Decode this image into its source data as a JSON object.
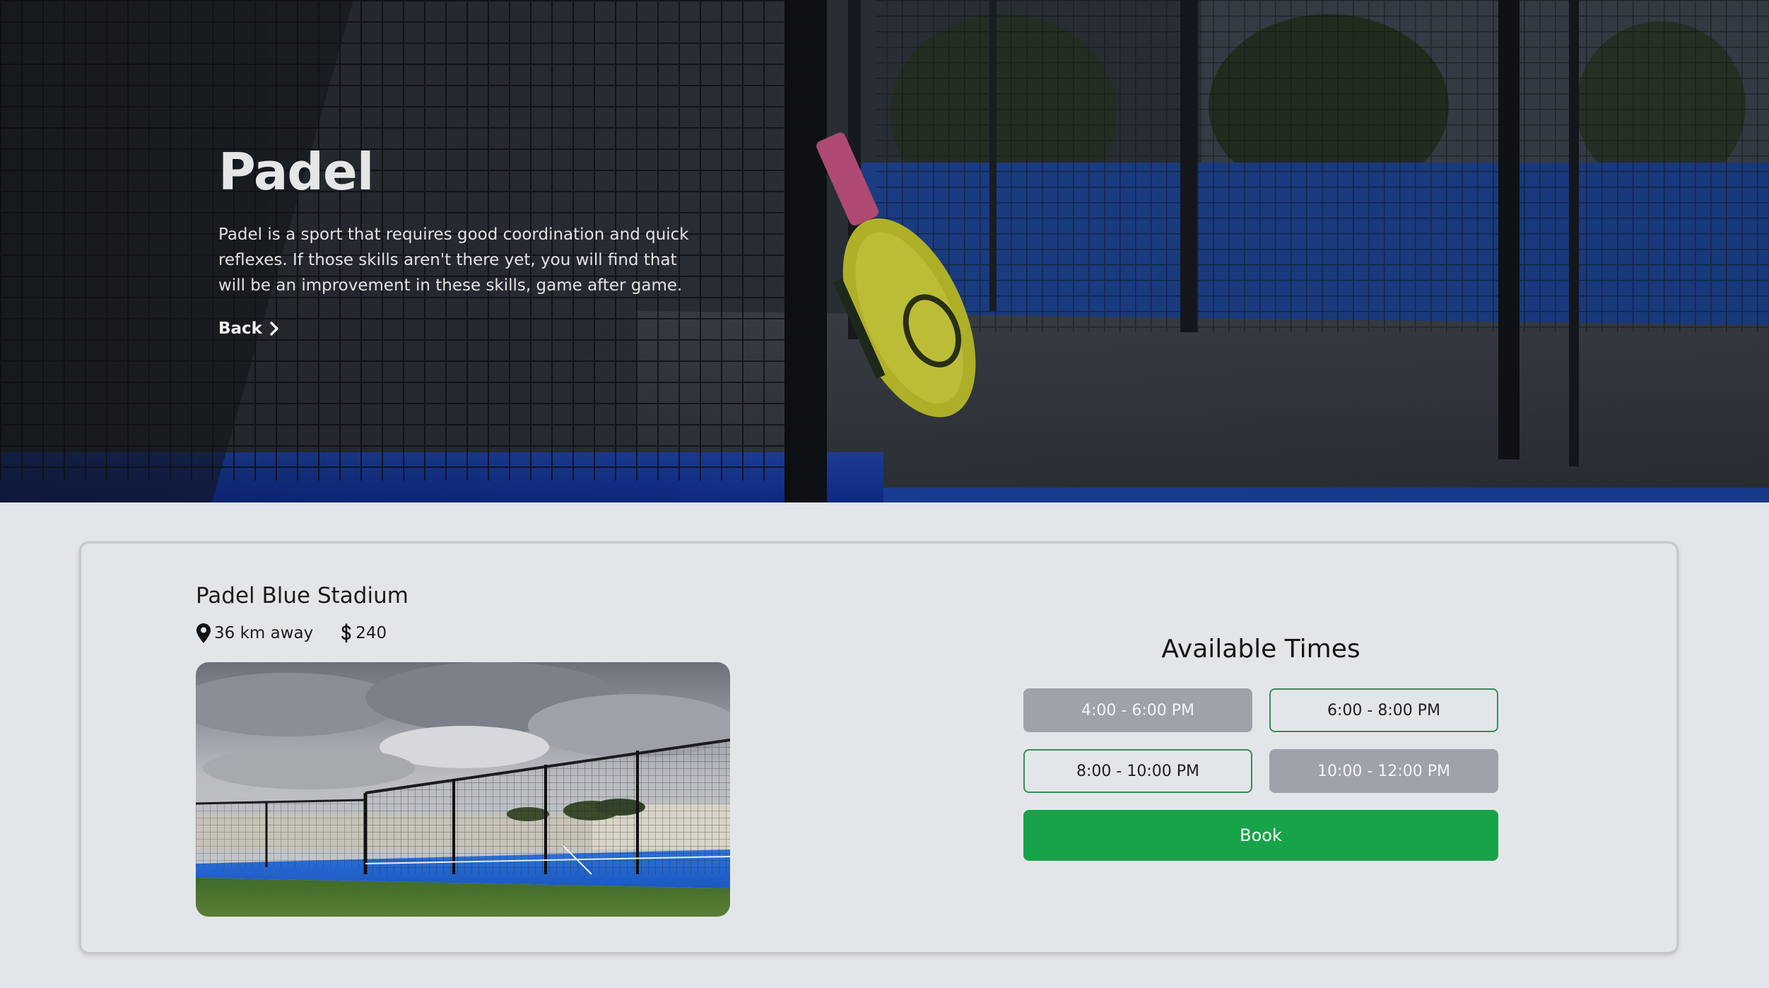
{
  "hero": {
    "title": "Padel",
    "description": "Padel is a sport that requires good coordination and quick reflexes. If those skills aren't there yet, you will find that will be an improvement in these skills, game after game.",
    "back_label": "Back",
    "back_icon": "chevron-right-icon"
  },
  "venue": {
    "name": "Padel Blue Stadium",
    "distance": "36 km away",
    "distance_icon": "map-pin-icon",
    "price": "240",
    "price_icon": "dollar-icon"
  },
  "times": {
    "title": "Available Times",
    "slots": [
      {
        "label": "4:00 - 6:00 PM",
        "state": "unavailable"
      },
      {
        "label": "6:00 - 8:00 PM",
        "state": "available"
      },
      {
        "label": "8:00 - 10:00 PM",
        "state": "available"
      },
      {
        "label": "10:00 - 12:00 PM",
        "state": "unavailable"
      }
    ],
    "book_label": "Book"
  },
  "colors": {
    "page_background": "#e3e6e8",
    "unavailable_slot": "#9ea2ab",
    "available_border": "#3a8a5c",
    "book_button": "#17a34a",
    "court_blue": "#1e63c9"
  }
}
